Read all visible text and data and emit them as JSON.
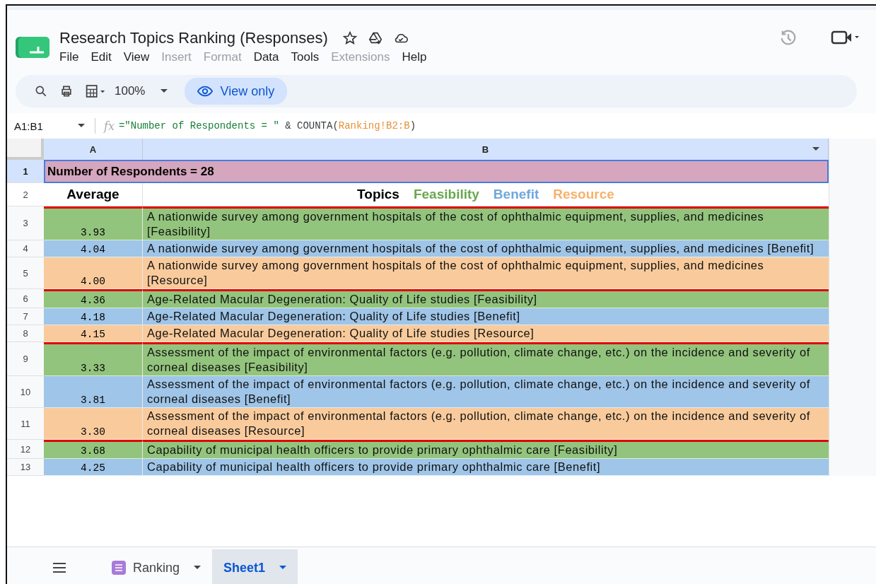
{
  "document": {
    "title": "Research Topics Ranking (Responses)"
  },
  "menu": [
    {
      "label": "File",
      "disabled": false
    },
    {
      "label": "Edit",
      "disabled": false
    },
    {
      "label": "View",
      "disabled": false
    },
    {
      "label": "Insert",
      "disabled": true
    },
    {
      "label": "Format",
      "disabled": true
    },
    {
      "label": "Data",
      "disabled": false
    },
    {
      "label": "Tools",
      "disabled": false
    },
    {
      "label": "Extensions",
      "disabled": true
    },
    {
      "label": "Help",
      "disabled": false
    }
  ],
  "toolbar": {
    "zoom": "100%",
    "mode_button": "View only"
  },
  "formula_bar": {
    "name_box": "A1:B1",
    "function_label": "fx",
    "formula_parts": [
      {
        "text": "=\"Number of Respondents = \"",
        "kind": "string"
      },
      {
        "text": " & COUNTA(",
        "kind": "plain"
      },
      {
        "text": "Ranking!B2:B",
        "kind": "range"
      },
      {
        "text": ")",
        "kind": "plain"
      }
    ]
  },
  "columns": [
    "A",
    "B"
  ],
  "title_row": {
    "number": "1",
    "text": "Number of Respondents = 28"
  },
  "header_row": {
    "number": "2",
    "average": "Average",
    "topics": "Topics",
    "legend": [
      {
        "label": "Feasibility",
        "color": "#6aa84f"
      },
      {
        "label": "Benefit",
        "color": "#6fa8dc"
      },
      {
        "label": "Resource",
        "color": "#f6b26b"
      }
    ]
  },
  "rows": [
    {
      "number": "3",
      "value": "3.93",
      "topic": "A nationwide survey among government hospitals of the cost of ophthalmic equipment, supplies, and medicines [Feasibility]",
      "kind": "feasibility",
      "separator_above": true
    },
    {
      "number": "4",
      "value": "4.04",
      "topic": "A nationwide survey among government hospitals of the cost of ophthalmic equipment, supplies, and medicines [Benefit]",
      "kind": "benefit",
      "separator_above": false
    },
    {
      "number": "5",
      "value": "4.00",
      "topic": "A nationwide survey among government hospitals of the cost of ophthalmic equipment, supplies, and medicines [Resource]",
      "kind": "resource",
      "separator_above": false
    },
    {
      "number": "6",
      "value": "4.36",
      "topic": "Age-Related Macular Degeneration: Quality of Life studies [Feasibility]",
      "kind": "feasibility",
      "separator_above": true
    },
    {
      "number": "7",
      "value": "4.18",
      "topic": "Age-Related Macular Degeneration: Quality of Life studies [Benefit]",
      "kind": "benefit",
      "separator_above": false
    },
    {
      "number": "8",
      "value": "4.15",
      "topic": "Age-Related Macular Degeneration: Quality of Life studies [Resource]",
      "kind": "resource",
      "separator_above": false
    },
    {
      "number": "9",
      "value": "3.33",
      "topic": "Assessment of the impact of environmental factors (e.g. pollution, climate change, etc.) on the incidence and severity of corneal diseases [Feasibility]",
      "kind": "feasibility",
      "separator_above": true
    },
    {
      "number": "10",
      "value": "3.81",
      "topic": "Assessment of the impact of environmental factors (e.g. pollution, climate change, etc.) on the incidence and severity of corneal diseases [Benefit]",
      "kind": "benefit",
      "separator_above": false
    },
    {
      "number": "11",
      "value": "3.30",
      "topic": "Assessment of the impact of environmental factors (e.g. pollution, climate change, etc.) on the incidence and severity of corneal diseases [Resource]",
      "kind": "resource",
      "separator_above": false
    },
    {
      "number": "12",
      "value": "3.68",
      "topic": "Capability of municipal health officers to provide primary ophthalmic care [Feasibility]",
      "kind": "feasibility",
      "separator_above": true
    },
    {
      "number": "13",
      "value": "4.25",
      "topic": "Capability of municipal health officers to provide primary ophthalmic care [Benefit]",
      "kind": "benefit",
      "separator_above": false
    }
  ],
  "sheet_tabs": [
    {
      "label": "Ranking",
      "selected": false
    },
    {
      "label": "Sheet1",
      "selected": true
    }
  ]
}
